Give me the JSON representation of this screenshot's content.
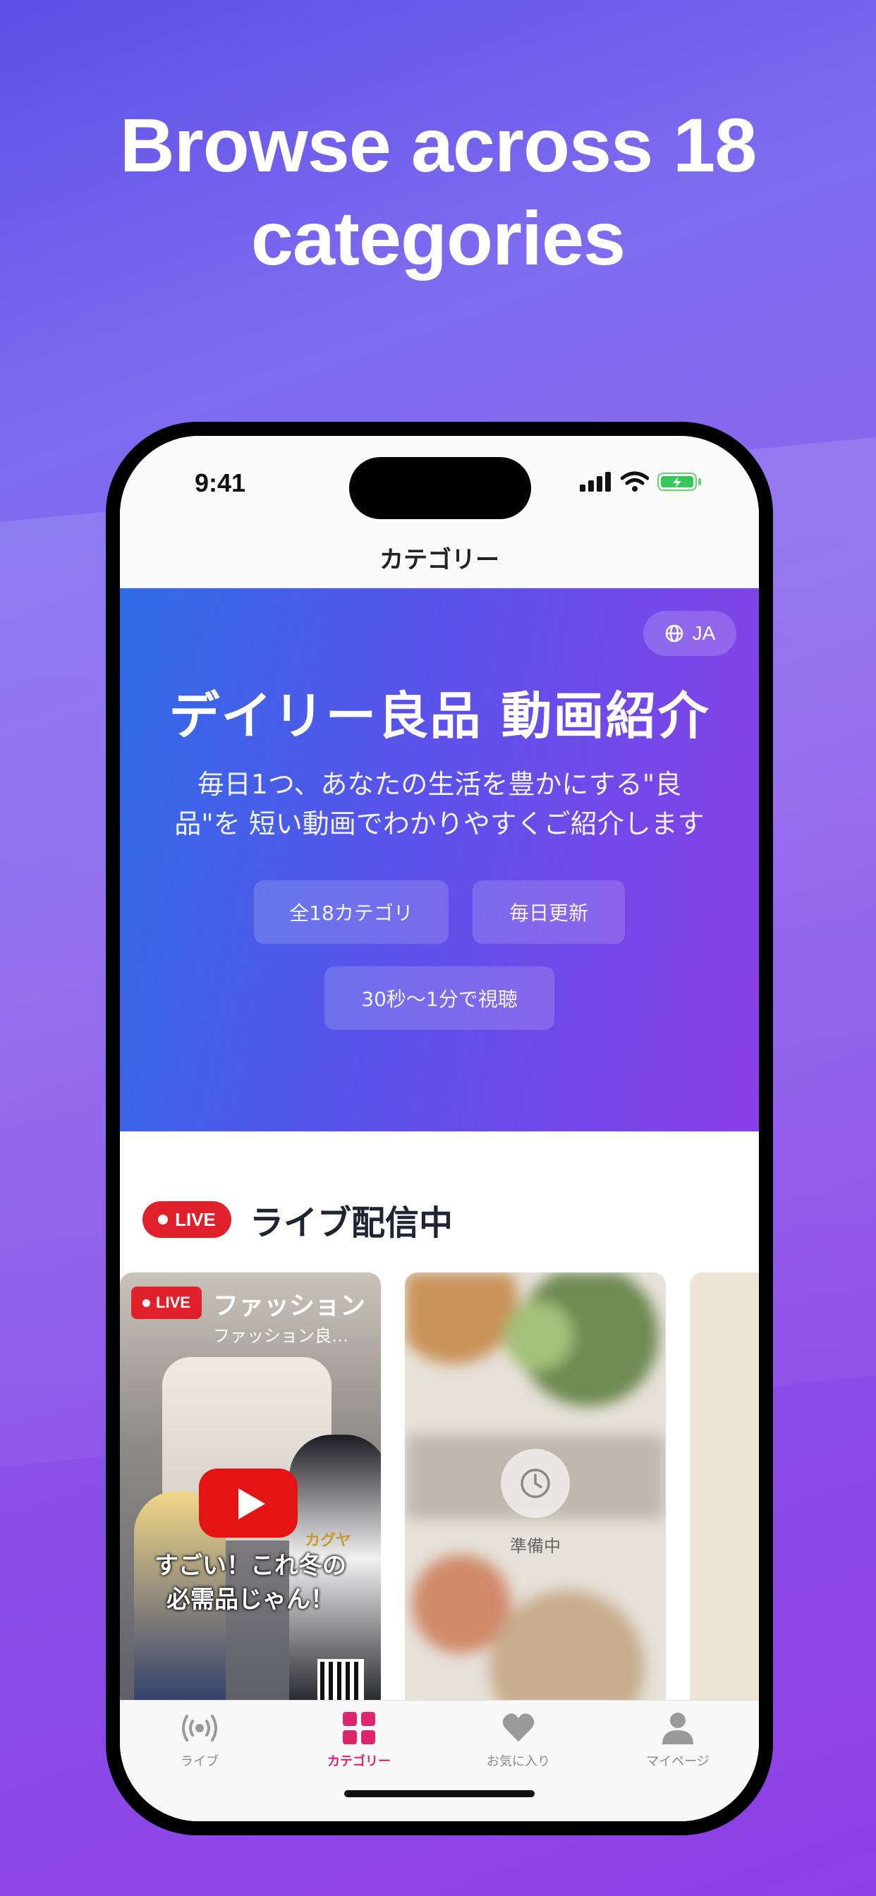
{
  "promo": {
    "headline_line1": "Browse across 18",
    "headline_line2": "categories"
  },
  "status_bar": {
    "time": "9:41"
  },
  "nav": {
    "title": "カテゴリー"
  },
  "hero": {
    "lang": "JA",
    "title": "デイリー良品 動画紹介",
    "subtitle_line1": "毎日1つ、あなたの生活を豊かにする\"良",
    "subtitle_line2": "品\"を 短い動画でわかりやすくご紹介します",
    "chips": [
      "全18カテゴリ",
      "毎日更新",
      "30秒〜1分で視聴"
    ]
  },
  "live": {
    "badge": "LIVE",
    "section_title": "ライブ配信中",
    "cards": [
      {
        "badge": "LIVE",
        "title": "ファッション",
        "subtitle": "ファッション良…",
        "caption_line1": "すごい！これ冬の",
        "caption_line2": "必需品じゃん！",
        "character_name": "カグヤ"
      },
      {
        "status": "準備中"
      }
    ]
  },
  "tabbar": {
    "items": [
      {
        "label": "ライブ",
        "icon": "broadcast-icon",
        "active": false
      },
      {
        "label": "カテゴリー",
        "icon": "grid-icon",
        "active": true
      },
      {
        "label": "お気に入り",
        "icon": "heart-icon",
        "active": false
      },
      {
        "label": "マイページ",
        "icon": "person-icon",
        "active": false
      }
    ],
    "active_color": "#e0256f"
  },
  "colors": {
    "live_red": "#e0202b",
    "hero_start": "#2f6be6",
    "hero_end": "#8a3fe6"
  }
}
